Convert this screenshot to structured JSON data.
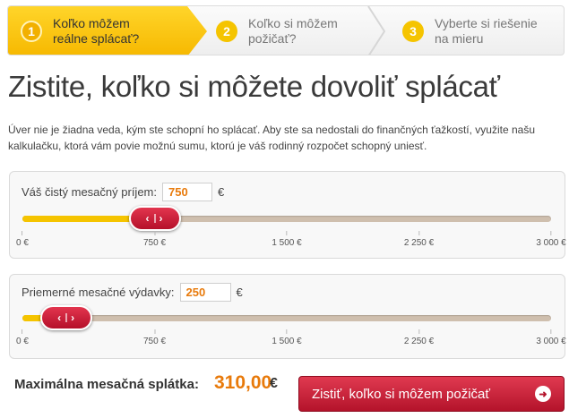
{
  "steps": [
    {
      "number": "1",
      "label_line1": "Koľko môžem",
      "label_line2": "reálne splácať?",
      "active": true
    },
    {
      "number": "2",
      "label_line1": "Koľko si môžem",
      "label_line2": "požičať?",
      "active": false
    },
    {
      "number": "3",
      "label_line1": "Vyberte si riešenie",
      "label_line2": "na mieru",
      "active": false
    }
  ],
  "page": {
    "title": "Zistite, koľko si môžete dovoliť splácať",
    "intro": "Úver nie je žiadna veda, kým ste schopní ho splácať. Aby ste sa nedostali do finančných ťažkostí, využite našu kalkulačku, ktorá vám povie možnú sumu, ktorú je váš rodinný rozpočet schopný uniesť."
  },
  "income": {
    "label": "Váš čistý mesačný príjem:",
    "value": "750",
    "currency": "€",
    "slider_min": 0,
    "slider_max": 3000,
    "slider_value": 750,
    "ticks": [
      "0 €",
      "750 €",
      "1 500 €",
      "2 250 €",
      "3 000 €"
    ]
  },
  "expenses": {
    "label": "Priemerné mesačné výdavky:",
    "value": "250",
    "currency": "€",
    "slider_min": 0,
    "slider_max": 3000,
    "slider_value": 250,
    "ticks": [
      "0 €",
      "750 €",
      "1 500 €",
      "2 250 €",
      "3 000 €"
    ]
  },
  "result": {
    "label": "Maximálna mesačná splátka:",
    "value": "310,00",
    "currency": "€"
  },
  "cta": {
    "label": "Zistiť, koľko si môžem požičať",
    "icon": "arrow-right-icon"
  },
  "colors": {
    "accent_yellow": "#f5c400",
    "brand_red": "#c41e3a",
    "value_orange": "#e87a0b"
  }
}
